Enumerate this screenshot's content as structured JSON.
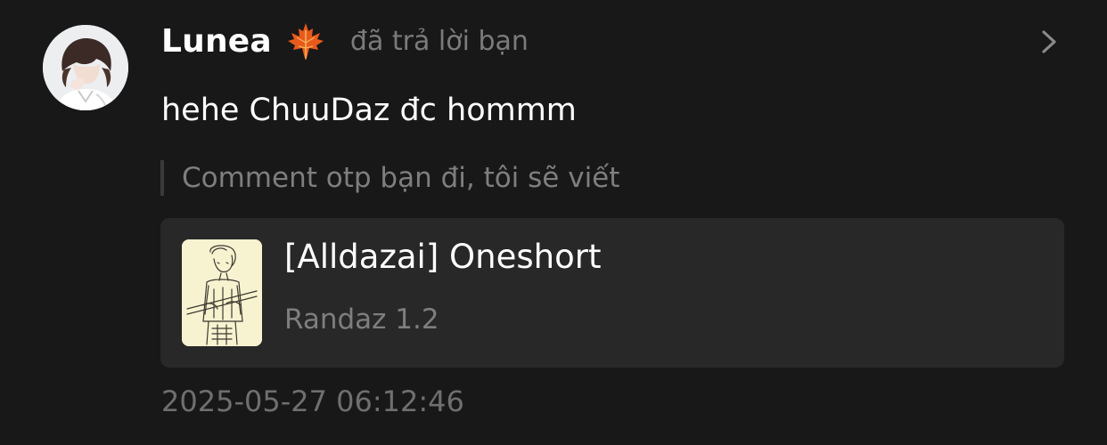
{
  "notification": {
    "user": {
      "name": "Lunea",
      "badge_icon": "maple-leaf-icon",
      "avatar_icon": "user-avatar"
    },
    "action_text": "đã trả lời bạn",
    "message": "hehe ChuuDaz đc hommm",
    "quoted_comment": "Comment otp bạn đi, tôi sẽ viết",
    "story": {
      "title": "[Alldazai] Oneshort",
      "subtitle": "Randaz 1.2",
      "cover_icon": "story-cover-image"
    },
    "timestamp": "2025-05-27 06:12:46",
    "open_icon": "chevron-right-icon"
  },
  "colors": {
    "background": "#181818",
    "card": "#282828",
    "primary_text": "#ffffff",
    "secondary_text": "#7e7e7e",
    "leaf": "#e85a1c"
  }
}
